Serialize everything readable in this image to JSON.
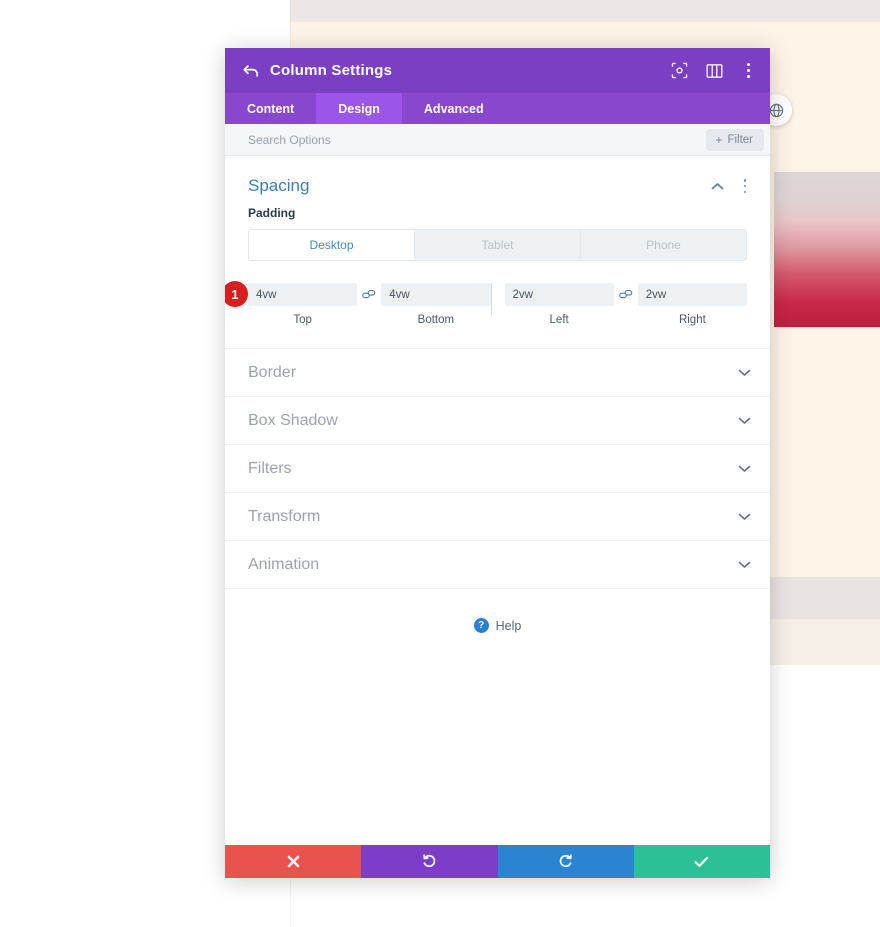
{
  "background": {
    "globe_icon": "globe-icon"
  },
  "modal": {
    "title": "Column Settings",
    "back_icon": "back-arrow-icon",
    "titlebar_icons": [
      {
        "name": "focus-target-icon"
      },
      {
        "name": "layout-columns-icon"
      },
      {
        "name": "more-vertical-icon"
      }
    ],
    "tabs": [
      {
        "label": "Content",
        "active": false
      },
      {
        "label": "Design",
        "active": true
      },
      {
        "label": "Advanced",
        "active": false
      }
    ],
    "search": {
      "placeholder": "Search Options",
      "value": "",
      "filter_label": "Filter",
      "filter_plus": "+"
    },
    "spacing": {
      "title": "Spacing",
      "collapse_icon": "chevron-up-icon",
      "options_icon": "more-vertical-icon",
      "padding_label": "Padding",
      "device_tabs": [
        {
          "label": "Desktop",
          "active": true
        },
        {
          "label": "Tablet",
          "active": false
        },
        {
          "label": "Phone",
          "active": false
        }
      ],
      "badge": "1",
      "link_icon": "link-chain-icon",
      "fields": [
        {
          "caption": "Top",
          "value": "4vw"
        },
        {
          "caption": "Bottom",
          "value": "4vw"
        },
        {
          "caption": "Left",
          "value": "2vw"
        },
        {
          "caption": "Right",
          "value": "2vw"
        }
      ]
    },
    "collapsed_groups": [
      {
        "label": "Border",
        "icon": "chevron-down-icon"
      },
      {
        "label": "Box Shadow",
        "icon": "chevron-down-icon"
      },
      {
        "label": "Filters",
        "icon": "chevron-down-icon"
      },
      {
        "label": "Transform",
        "icon": "chevron-down-icon"
      },
      {
        "label": "Animation",
        "icon": "chevron-down-icon"
      }
    ],
    "help": {
      "label": "Help",
      "icon_glyph": "?"
    },
    "footer": [
      {
        "name": "cancel-button",
        "icon": "close-x-icon",
        "color": "#e9534f"
      },
      {
        "name": "undo-button",
        "icon": "undo-icon",
        "color": "#7c3ec8"
      },
      {
        "name": "redo-button",
        "icon": "redo-icon",
        "color": "#2a84d2"
      },
      {
        "name": "save-button",
        "icon": "check-icon",
        "color": "#29c195"
      }
    ]
  }
}
